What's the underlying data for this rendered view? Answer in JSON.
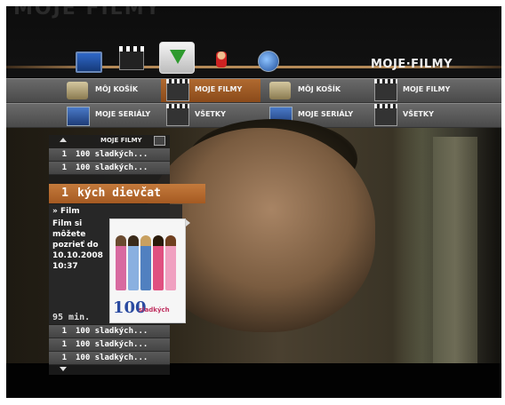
{
  "ghost_text": "MOJE FILMY",
  "header": {
    "section_title": "MOJE·FILMY"
  },
  "dock_icons": [
    "tv-icon",
    "clapperboard-icon",
    "download-icon",
    "user-icon",
    "globe-icon"
  ],
  "nav": {
    "row1": [
      {
        "label": "MÔJ KOŠÍK",
        "icon": "cart-icon",
        "active": false
      },
      {
        "label": "MOJE FILMY",
        "icon": "film-icon",
        "active": true
      },
      {
        "label": "MÔJ KOŠÍK",
        "icon": "cart-icon",
        "active": false
      },
      {
        "label": "MOJE FILMY",
        "icon": "film-icon",
        "active": false
      }
    ],
    "row2": [
      {
        "label": "MOJE SERIÁLY",
        "icon": "tv-icon",
        "active": false
      },
      {
        "label": "VŠETKY",
        "icon": "film-icon",
        "active": false
      },
      {
        "label": "MOJE SERIÁLY",
        "icon": "tv-icon",
        "active": false
      },
      {
        "label": "VŠETKY",
        "icon": "film-icon",
        "active": false
      }
    ]
  },
  "panel": {
    "title": "MOJE FILMY",
    "items_above": [
      {
        "num": "1",
        "title": "100 sladkých..."
      },
      {
        "num": "1",
        "title": "100 sladkých..."
      }
    ],
    "selected": {
      "num": "1",
      "title": "kých dievčat"
    },
    "detail": {
      "type": "» Film",
      "text": "Film si môžete pozrieť do 10.10.2008 10:37",
      "duration": "95 min.",
      "poster": {
        "title": "100",
        "subtitle": "sladkých"
      }
    },
    "items_below": [
      {
        "num": "1",
        "title": "100 sladkých..."
      },
      {
        "num": "1",
        "title": "100 sladkých..."
      },
      {
        "num": "1",
        "title": "100 sladkých..."
      }
    ]
  },
  "colors": {
    "accent": "#b06a30",
    "nav_bg": "#5a5a5a",
    "selected_row": "#c47a3c"
  }
}
